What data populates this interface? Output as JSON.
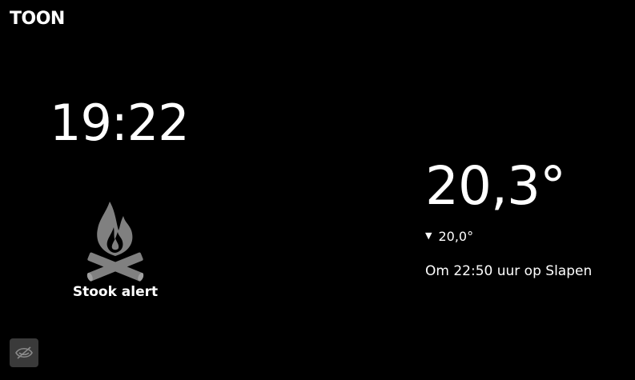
{
  "brand": {
    "logo_text": "TOON"
  },
  "clock": {
    "time": "19:22"
  },
  "alert": {
    "icon": "campfire-icon",
    "label": "Stook alert",
    "icon_color": "#808080"
  },
  "thermostat": {
    "current_temperature": "20,3°",
    "setpoint_indicator": "▼",
    "setpoint": "20,0°",
    "schedule_text": "Om 22:50 uur op Slapen"
  },
  "controls": {
    "dim_toggle_icon": "eye-off-icon",
    "button_color": "#3a3a3a"
  }
}
